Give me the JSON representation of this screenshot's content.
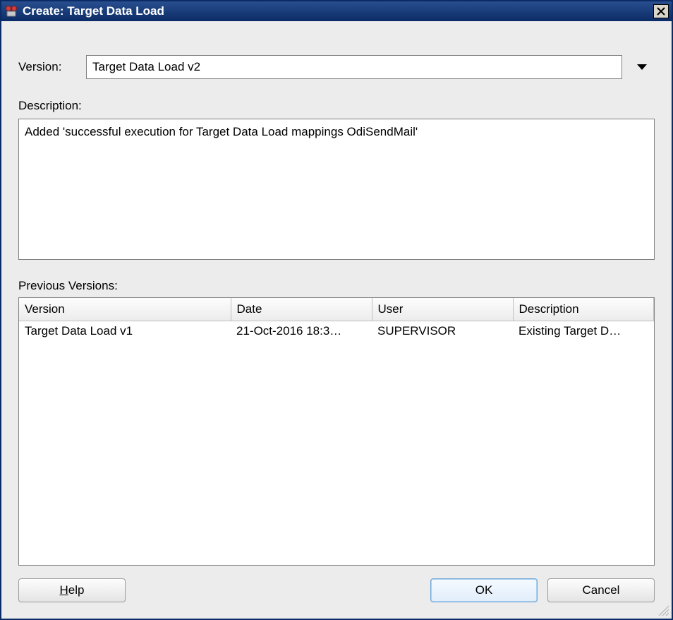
{
  "window": {
    "title": "Create: Target Data Load"
  },
  "form": {
    "version_label": "Version:",
    "version_value": "Target Data Load v2",
    "description_label": "Description:",
    "description_value": "Added 'successful execution for Target Data Load mappings OdiSendMail'",
    "previous_versions_label": "Previous Versions:"
  },
  "prev_table": {
    "headers": {
      "version": "Version",
      "date": "Date",
      "user": "User",
      "description": "Description"
    },
    "rows": [
      {
        "version": "Target Data Load v1",
        "date": "21-Oct-2016 18:3…",
        "user": "SUPERVISOR",
        "description": "Existing Target D…"
      }
    ]
  },
  "buttons": {
    "help": "Help",
    "ok": "OK",
    "cancel": "Cancel"
  }
}
